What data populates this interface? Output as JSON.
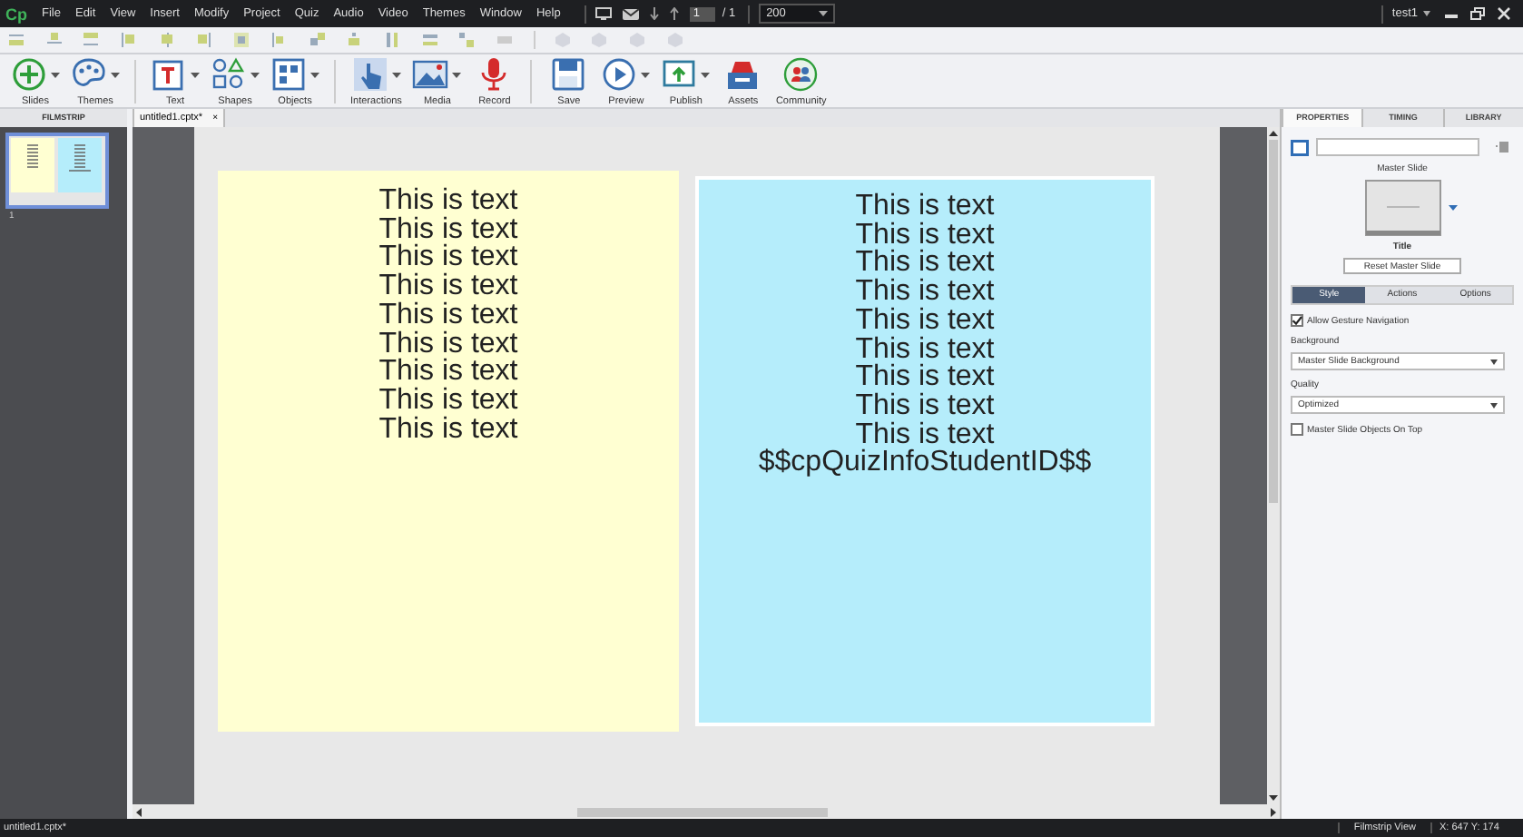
{
  "title_bar": {
    "logo": "Cp",
    "menu": [
      "File",
      "Edit",
      "View",
      "Insert",
      "Modify",
      "Project",
      "Quiz",
      "Audio",
      "Video",
      "Themes",
      "Window",
      "Help"
    ],
    "page_field": "1",
    "page_total": "/ 1",
    "zoom": "200",
    "workspace": "test1"
  },
  "ribbon_groups": [
    [
      {
        "label": "Slides",
        "kind": "slides",
        "caret": true
      },
      {
        "label": "Themes",
        "kind": "themes",
        "caret": true
      }
    ],
    [
      {
        "label": "Text",
        "kind": "text",
        "caret": true
      },
      {
        "label": "Shapes",
        "kind": "shapes",
        "caret": true
      },
      {
        "label": "Objects",
        "kind": "objects",
        "caret": true
      }
    ],
    [
      {
        "label": "Interactions",
        "kind": "interactions",
        "caret": true
      },
      {
        "label": "Media",
        "kind": "media",
        "caret": true
      },
      {
        "label": "Record",
        "kind": "record",
        "caret": false
      }
    ],
    [
      {
        "label": "Save",
        "kind": "save",
        "caret": false
      },
      {
        "label": "Preview",
        "kind": "preview",
        "caret": true
      },
      {
        "label": "Publish",
        "kind": "publish",
        "caret": true
      },
      {
        "label": "Assets",
        "kind": "assets",
        "caret": false
      },
      {
        "label": "Community",
        "kind": "community",
        "caret": false
      }
    ]
  ],
  "filmstrip": {
    "title": "FILMSTRIP",
    "slides": [
      {
        "number": "1",
        "selected": true
      }
    ]
  },
  "document_tab": {
    "label": "untitled1.cptx*",
    "close": "×"
  },
  "stage": {
    "boxes": [
      {
        "color": "#ffffd2",
        "lines": [
          "This is text",
          "This is text",
          "This is text",
          "This is text",
          "This is text",
          "This is text",
          "This is text",
          "This is text",
          "This is text"
        ]
      },
      {
        "color": "#b5edfb",
        "lines": [
          "This is text",
          "This is text",
          "This is text",
          "This is text",
          "This is text",
          "This is text",
          "This is text",
          "This is text",
          "This is text",
          "$$cpQuizInfoStudentID$$"
        ]
      }
    ]
  },
  "properties": {
    "tabs": [
      {
        "label": "PROPERTIES",
        "selected": true
      },
      {
        "label": "TIMING",
        "selected": false
      },
      {
        "label": "LIBRARY",
        "selected": false
      }
    ],
    "master_slide_label": "Master Slide",
    "master_name": "Title",
    "reset_button": "Reset Master Slide",
    "sub_tabs": [
      {
        "label": "Style",
        "selected": true
      },
      {
        "label": "Actions",
        "selected": false
      },
      {
        "label": "Options",
        "selected": false
      }
    ],
    "gesture": {
      "label": "Allow Gesture Navigation",
      "checked": true
    },
    "background": {
      "label": "Background",
      "value": "Master Slide Background"
    },
    "quality": {
      "label": "Quality",
      "value": "Optimized"
    },
    "objects_on_top": {
      "label": "Master Slide Objects On Top",
      "checked": false
    }
  },
  "status_bar": {
    "file": "untitled1.cptx*",
    "view": "Filmstrip View",
    "coords": "X: 647 Y: 174"
  }
}
